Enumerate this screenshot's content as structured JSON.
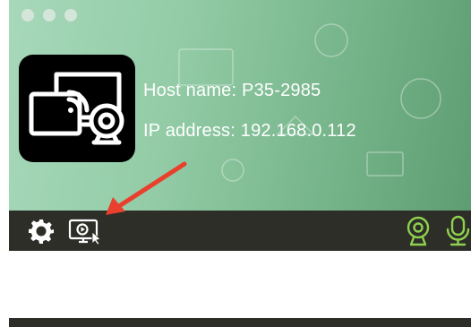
{
  "window": {
    "buttons": [
      "close",
      "minimize",
      "maximize"
    ]
  },
  "device": {
    "host_label": "Host name:",
    "host_value": "P35-2985",
    "ip_label": "IP address:",
    "ip_value": "192.168.0.112"
  },
  "toolbar": {
    "left_icons": [
      "gear-icon",
      "screen-share-icon"
    ],
    "right_icons": [
      "webcam-icon",
      "microphone-icon"
    ]
  },
  "annotation": {
    "arrow_color": "#e8402c",
    "points_to": "screen-share-icon"
  },
  "colors": {
    "toolbar_bg": "#2d2e28",
    "icon_white": "#ffffff",
    "icon_green": "#8fd14f"
  }
}
